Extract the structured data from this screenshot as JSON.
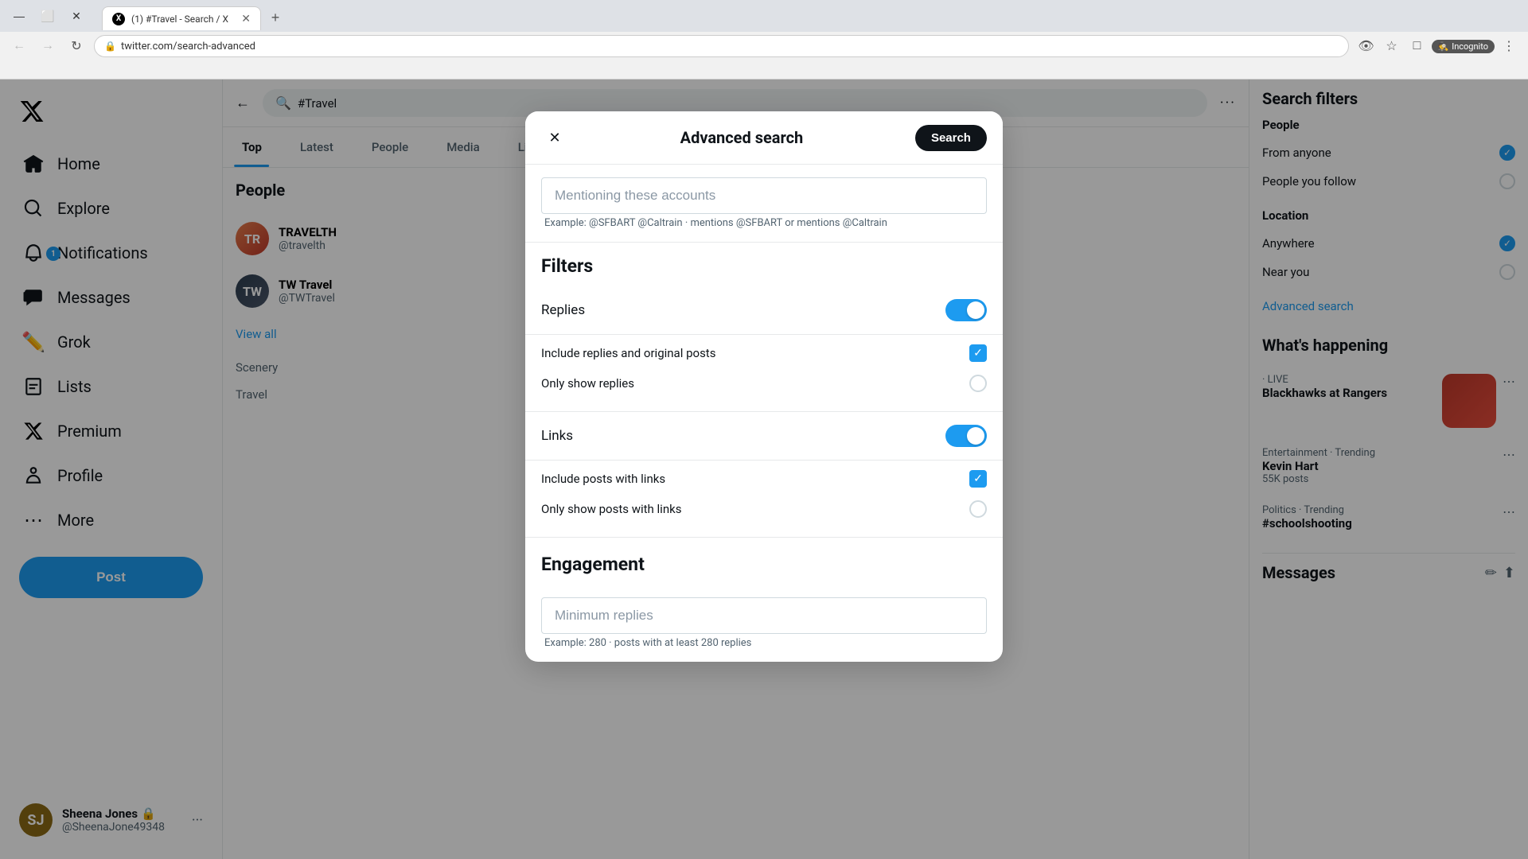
{
  "browser": {
    "tab_title": "(1) #Travel - Search / X",
    "tab_favicon": "X",
    "url": "twitter.com/search-advanced",
    "new_tab_label": "+",
    "back_btn": "←",
    "forward_btn": "→",
    "refresh_btn": "↻",
    "incognito_label": "Incognito",
    "window_controls": {
      "minimize": "—",
      "maximize": "⬜",
      "close": "✕"
    }
  },
  "sidebar": {
    "logo": "X",
    "items": [
      {
        "id": "home",
        "label": "Home",
        "icon": "🏠"
      },
      {
        "id": "explore",
        "label": "Explore",
        "icon": "🔍"
      },
      {
        "id": "notifications",
        "label": "Notifications",
        "icon": "🔔",
        "badge": "1"
      },
      {
        "id": "messages",
        "label": "Messages",
        "icon": "✉"
      },
      {
        "id": "grok",
        "label": "Grok",
        "icon": "✏"
      },
      {
        "id": "lists",
        "label": "Lists",
        "icon": "≡"
      },
      {
        "id": "premium",
        "label": "Premium",
        "icon": "✕"
      },
      {
        "id": "profile",
        "label": "Profile",
        "icon": "👤"
      },
      {
        "id": "more",
        "label": "More",
        "icon": "⋯"
      }
    ],
    "post_button": "Post",
    "user": {
      "name": "Sheena Jones",
      "verified": "🔒",
      "handle": "@SheenaJone49348",
      "initials": "SJ"
    }
  },
  "search_header": {
    "query": "#Travel",
    "more_options": "···"
  },
  "tabs": [
    {
      "id": "top",
      "label": "Top",
      "active": true
    },
    {
      "id": "latest",
      "label": "Latest",
      "active": false
    },
    {
      "id": "people",
      "label": "People",
      "active": false
    },
    {
      "id": "media",
      "label": "Media",
      "active": false
    },
    {
      "id": "lists",
      "label": "Lists",
      "active": false
    }
  ],
  "people_section": {
    "title": "People",
    "items": [
      {
        "id": "1",
        "initials": "TR",
        "color": "#e57c4a"
      },
      {
        "id": "2",
        "initials": "TW",
        "color": "#4a6ee5"
      }
    ],
    "view_all": "View all"
  },
  "right_sidebar": {
    "search_filters_title": "Search filters",
    "people_section": {
      "title": "People",
      "options": [
        {
          "label": "From anyone",
          "selected": true
        },
        {
          "label": "People you follow",
          "selected": false
        }
      ]
    },
    "location_section": {
      "title": "Location",
      "options": [
        {
          "label": "Anywhere",
          "selected": true
        },
        {
          "label": "Near you",
          "selected": false
        }
      ]
    },
    "advanced_search_link": "Advanced search",
    "whats_happening_title": "What's happening",
    "trending_items": [
      {
        "category": "· LIVE",
        "topic": "Blackhawks at Rangers",
        "has_image": true,
        "image_color": "#c0392b"
      },
      {
        "category": "Entertainment · Trending",
        "topic": "Kevin Hart",
        "count": "55K posts"
      },
      {
        "category": "Politics · Trending",
        "topic": "#schoolshooting",
        "count": ""
      }
    ],
    "messages_title": "Messages"
  },
  "modal": {
    "title": "Advanced search",
    "search_button": "Search",
    "close_button": "✕",
    "mentioning_placeholder": "Mentioning these accounts",
    "mentioning_hint": "Example: @SFBART @Caltrain · mentions @SFBART or mentions @Caltrain",
    "filters_title": "Filters",
    "replies_label": "Replies",
    "replies_enabled": true,
    "include_replies_label": "Include replies and original posts",
    "include_replies_checked": true,
    "only_replies_label": "Only show replies",
    "only_replies_checked": false,
    "links_label": "Links",
    "links_enabled": true,
    "include_links_label": "Include posts with links",
    "include_links_checked": true,
    "only_links_label": "Only show posts with links",
    "only_links_checked": false,
    "engagement_title": "Engagement",
    "min_replies_placeholder": "Minimum replies",
    "engagement_hint": "Example: 280 · posts with at least 280 replies"
  }
}
